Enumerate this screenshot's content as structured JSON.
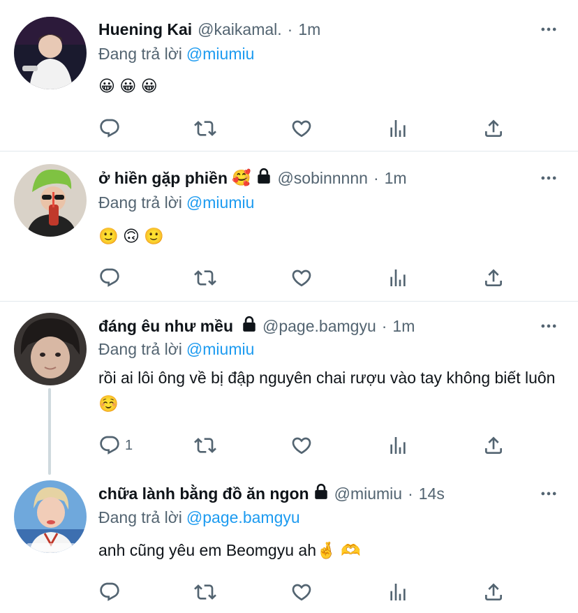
{
  "reply_prefix": "Đang trả lời",
  "tweets": [
    {
      "name": "Huening Kai",
      "handle": "@kaikamal.",
      "separator": "·",
      "time": "1m",
      "reply_to": "@miumiu",
      "text": "😀 😀 😀",
      "reply_count": "",
      "locked": false,
      "name_emoji": ""
    },
    {
      "name": "ở hiền gặp phiền",
      "handle": "@sobinnnnn",
      "separator": "·",
      "time": "1m",
      "reply_to": "@miumiu",
      "text": "🙂 🙃 🙂",
      "reply_count": "",
      "locked": true,
      "name_emoji": "🥰"
    },
    {
      "name": "đáng êu như mều",
      "handle": "@page.bamgyu",
      "separator": "·",
      "time": "1m",
      "reply_to": "@miumiu",
      "text": "rồi ai lôi ông về bị đập nguyên chai rượu vào tay không biết luôn☺️",
      "reply_count": "1",
      "locked": true,
      "name_emoji": ""
    },
    {
      "name": "chữa lành bằng đồ ăn ngon",
      "handle": "@miumiu",
      "separator": "·",
      "time": "14s",
      "reply_to": "@page.bamgyu",
      "text": "anh cũng yêu em Beomgyu ah🤞 🫶",
      "reply_count": "",
      "locked": true,
      "name_emoji": ""
    }
  ],
  "icons": {
    "reply": "reply-icon",
    "retweet": "retweet-icon",
    "like": "heart-icon",
    "views": "views-icon",
    "share": "share-icon",
    "more": "more-icon",
    "lock": "lock-icon"
  },
  "colors": {
    "accent": "#1d9bf0",
    "secondary_text": "#536471",
    "primary_text": "#0f1419",
    "divider": "#e1e8ed"
  }
}
